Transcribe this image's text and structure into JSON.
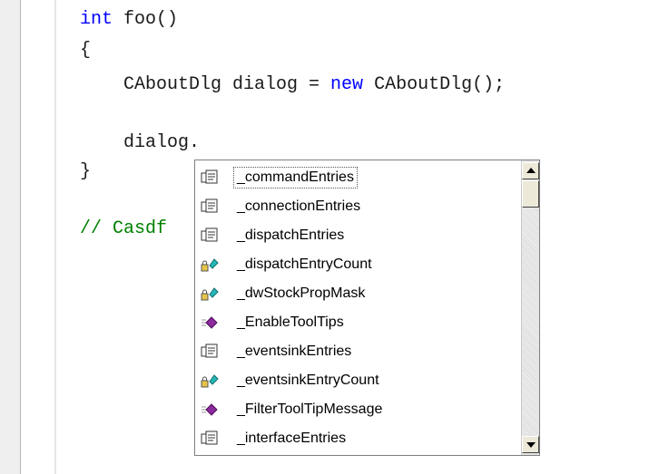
{
  "editor": {
    "line1_kw": "int",
    "line1_rest": " foo()",
    "line2": "{",
    "line3_a": "    CAboutDlg dialog = ",
    "line3_kw": "new",
    "line3_b": " CAboutDlg();",
    "line5": "    dialog.",
    "line6": "}",
    "line8": "// Casdf"
  },
  "autocomplete": {
    "items": [
      {
        "label": "_commandEntries",
        "icon": "struct-member-icon",
        "selected": true
      },
      {
        "label": "_connectionEntries",
        "icon": "struct-member-icon"
      },
      {
        "label": "_dispatchEntries",
        "icon": "struct-member-icon"
      },
      {
        "label": "_dispatchEntryCount",
        "icon": "private-field-icon"
      },
      {
        "label": "_dwStockPropMask",
        "icon": "private-field-icon"
      },
      {
        "label": "_EnableToolTips",
        "icon": "method-icon"
      },
      {
        "label": "_eventsinkEntries",
        "icon": "struct-member-icon"
      },
      {
        "label": "_eventsinkEntryCount",
        "icon": "private-field-icon"
      },
      {
        "label": "_FilterToolTipMessage",
        "icon": "method-icon"
      },
      {
        "label": "_interfaceEntries",
        "icon": "struct-member-icon"
      }
    ]
  },
  "colors": {
    "keyword": "#0000ff",
    "comment": "#008000"
  }
}
